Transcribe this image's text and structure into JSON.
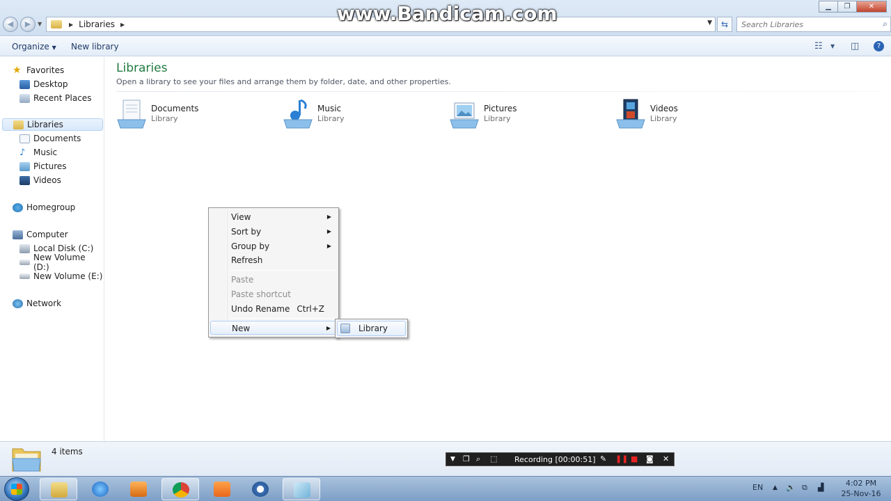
{
  "watermark": "www.Bandicam.com",
  "address": {
    "crumb": "Libraries"
  },
  "search": {
    "placeholder": "Search Libraries"
  },
  "toolbar": {
    "organize": "Organize",
    "new_library": "New library"
  },
  "sidebar": {
    "favorites": "Favorites",
    "desktop": "Desktop",
    "recent_places": "Recent Places",
    "libraries": "Libraries",
    "documents": "Documents",
    "music": "Music",
    "pictures": "Pictures",
    "videos": "Videos",
    "homegroup": "Homegroup",
    "computer": "Computer",
    "local_disk": "Local Disk (C:)",
    "volume_d": "New Volume (D:)",
    "volume_e": "New Volume (E:)",
    "network": "Network"
  },
  "main": {
    "title": "Libraries",
    "subtitle": "Open a library to see your files and arrange them by folder, date, and other properties.",
    "libraries": [
      {
        "name": "Documents",
        "type": "Library"
      },
      {
        "name": "Music",
        "type": "Library"
      },
      {
        "name": "Pictures",
        "type": "Library"
      },
      {
        "name": "Videos",
        "type": "Library"
      }
    ]
  },
  "context_menu": {
    "view": "View",
    "sort_by": "Sort by",
    "group_by": "Group by",
    "refresh": "Refresh",
    "paste": "Paste",
    "paste_shortcut": "Paste shortcut",
    "undo_rename": "Undo Rename",
    "undo_shortcut": "Ctrl+Z",
    "new": "New",
    "submenu_library": "Library"
  },
  "status": {
    "count": "4 items"
  },
  "recording": {
    "text": "Recording [00:00:51]"
  },
  "tray": {
    "lang": "EN",
    "time": "4:02 PM",
    "date": "25-Nov-16"
  },
  "colors": {
    "library_title": "#1f7a3f",
    "taskbar": "#7d9fc6",
    "menu_highlight": "#aecff7"
  }
}
